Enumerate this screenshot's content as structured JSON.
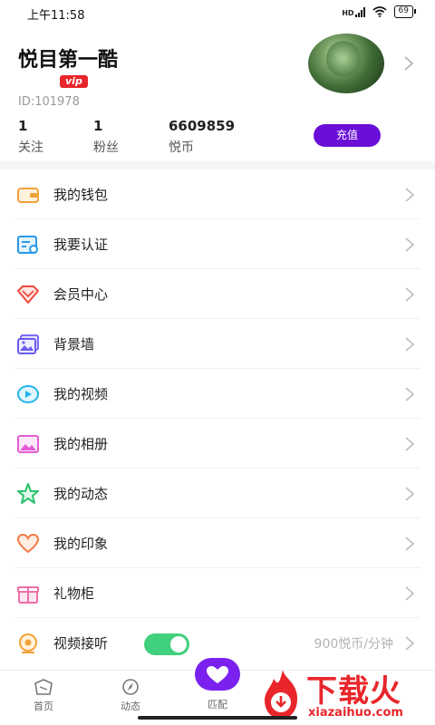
{
  "status_bar": {
    "time": "上午11:58",
    "network_label": "HD",
    "battery": "69"
  },
  "profile": {
    "nickname": "悦目第一酷",
    "vip_badge": "vip",
    "user_id": "ID:101978",
    "stats": [
      {
        "value": "1",
        "label": "关注"
      },
      {
        "value": "1",
        "label": "粉丝"
      },
      {
        "value": "6609859",
        "label": "悦币"
      }
    ],
    "recharge_label": "充值"
  },
  "menu": [
    {
      "label": "我的钱包",
      "icon": "wallet-icon",
      "color": "#f2a23a"
    },
    {
      "label": "我要认证",
      "icon": "certification-icon",
      "color": "#2a9ae6"
    },
    {
      "label": "会员中心",
      "icon": "diamond-icon",
      "color": "#ec4a3d"
    },
    {
      "label": "背景墙",
      "icon": "picture-wall-icon",
      "color": "#6a5cf0"
    },
    {
      "label": "我的视频",
      "icon": "play-video-icon",
      "color": "#22b5ec"
    },
    {
      "label": "我的相册",
      "icon": "album-icon",
      "color": "#e55dd6"
    },
    {
      "label": "我的动态",
      "icon": "star-icon",
      "color": "#29c36b"
    },
    {
      "label": "我的印象",
      "icon": "heart-icon",
      "color": "#f07a45"
    },
    {
      "label": "礼物柜",
      "icon": "gift-icon",
      "color": "#ee6fa8"
    }
  ],
  "video_answer": {
    "label": "视频接听",
    "toggle_on": true,
    "price": "900悦币/分钟",
    "icon": "video-call-icon"
  },
  "tabbar": [
    {
      "label": "首页",
      "icon": "home-icon"
    },
    {
      "label": "动态",
      "icon": "compass-icon"
    },
    {
      "label": "匹配",
      "icon": "match-hearts-icon"
    }
  ],
  "watermark": {
    "text": "下载火",
    "url": "xiazaihuo.com"
  },
  "colors": {
    "accent": "#6a0fd8",
    "toggle": "#41d07d",
    "vip": "#e8262b"
  }
}
